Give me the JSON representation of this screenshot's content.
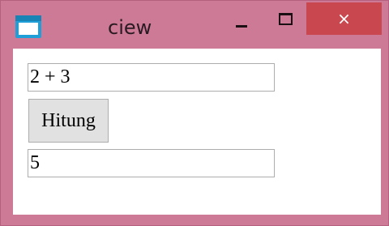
{
  "window": {
    "title": "ciew",
    "controls": {
      "close_glyph": "×"
    }
  },
  "form": {
    "expression_value": "2 + 3",
    "calculate_label": "Hitung",
    "result_value": "5"
  },
  "icons": {
    "app": "window-app-icon",
    "minimize": "minimize-icon",
    "maximize": "maximize-icon",
    "close": "close-icon"
  },
  "colors": {
    "frame": "#cc7a96",
    "close_button": "#c9484f",
    "app_icon": "#1e9fd8",
    "button_face": "#e1e1e1"
  }
}
